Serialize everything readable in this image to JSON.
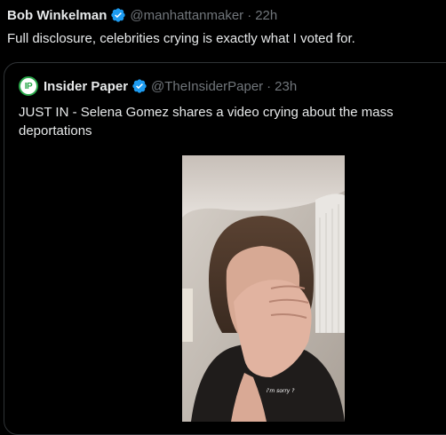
{
  "tweet": {
    "display_name": "Bob Winkelman",
    "handle": "@manhattanmaker",
    "separator": "·",
    "time": "22h",
    "text": "Full disclosure, celebrities crying is exactly what I voted for."
  },
  "quote": {
    "avatar_text": "IP",
    "display_name": "Insider Paper",
    "handle": "@TheInsiderPaper",
    "separator": "·",
    "time": "23h",
    "text": "JUST IN - Selena Gomez shares a video crying about the mass deportations"
  },
  "video": {
    "caption": "i'm sorry ?"
  },
  "colors": {
    "verified": "#1d9bf0",
    "muted": "#71767b",
    "avatar_accent": "#2aa84a"
  }
}
